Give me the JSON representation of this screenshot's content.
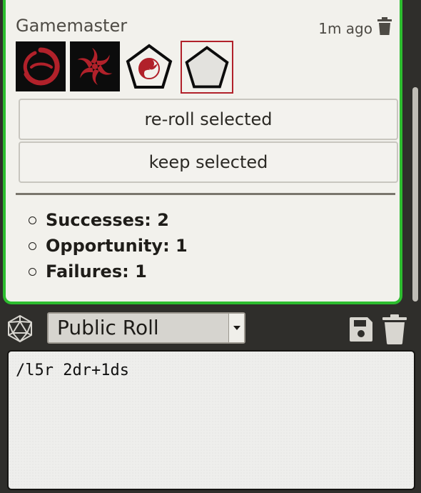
{
  "message": {
    "speaker": "Gamemaster",
    "timestamp": "1m ago",
    "dice": [
      {
        "name": "ring-die-success",
        "selected": false
      },
      {
        "name": "ring-die-explosive-opportunity",
        "selected": false
      },
      {
        "name": "skill-die-opportunity",
        "selected": false
      },
      {
        "name": "skill-die-blank",
        "selected": true
      }
    ],
    "reroll_label": "re-roll selected",
    "keep_label": "keep selected",
    "results": [
      {
        "label": "Successes: 2"
      },
      {
        "label": "Opportunity: 1"
      },
      {
        "label": "Failures: 1"
      }
    ]
  },
  "controls": {
    "roll_mode": "Public Roll"
  },
  "chat_input": {
    "value": "/l5r 2dr+1ds"
  },
  "colors": {
    "card_border": "#2dbd2f",
    "selected_border": "#b1212a",
    "die_red": "#b1212a"
  }
}
